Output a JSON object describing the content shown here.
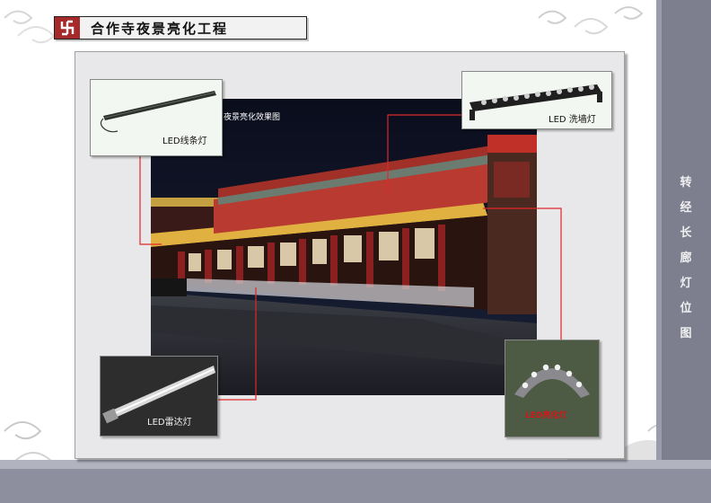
{
  "header": {
    "title": "合作寺夜景亮化工程",
    "logo_icon": "swastika-logo-icon"
  },
  "side_title": {
    "chars": [
      "转",
      "经",
      "长",
      "廊",
      "灯",
      "位",
      "图"
    ]
  },
  "scene": {
    "caption": "夜景亮化效果图"
  },
  "products": [
    {
      "label": "LED线条灯"
    },
    {
      "label": "LED 洗墙灯"
    },
    {
      "label": "LED雷达灯"
    },
    {
      "label": "LED亮化灯"
    }
  ],
  "colors": {
    "leader_line": "#e02828",
    "header_logo": "#a72a2a",
    "right_band": "#7d7f8f"
  }
}
